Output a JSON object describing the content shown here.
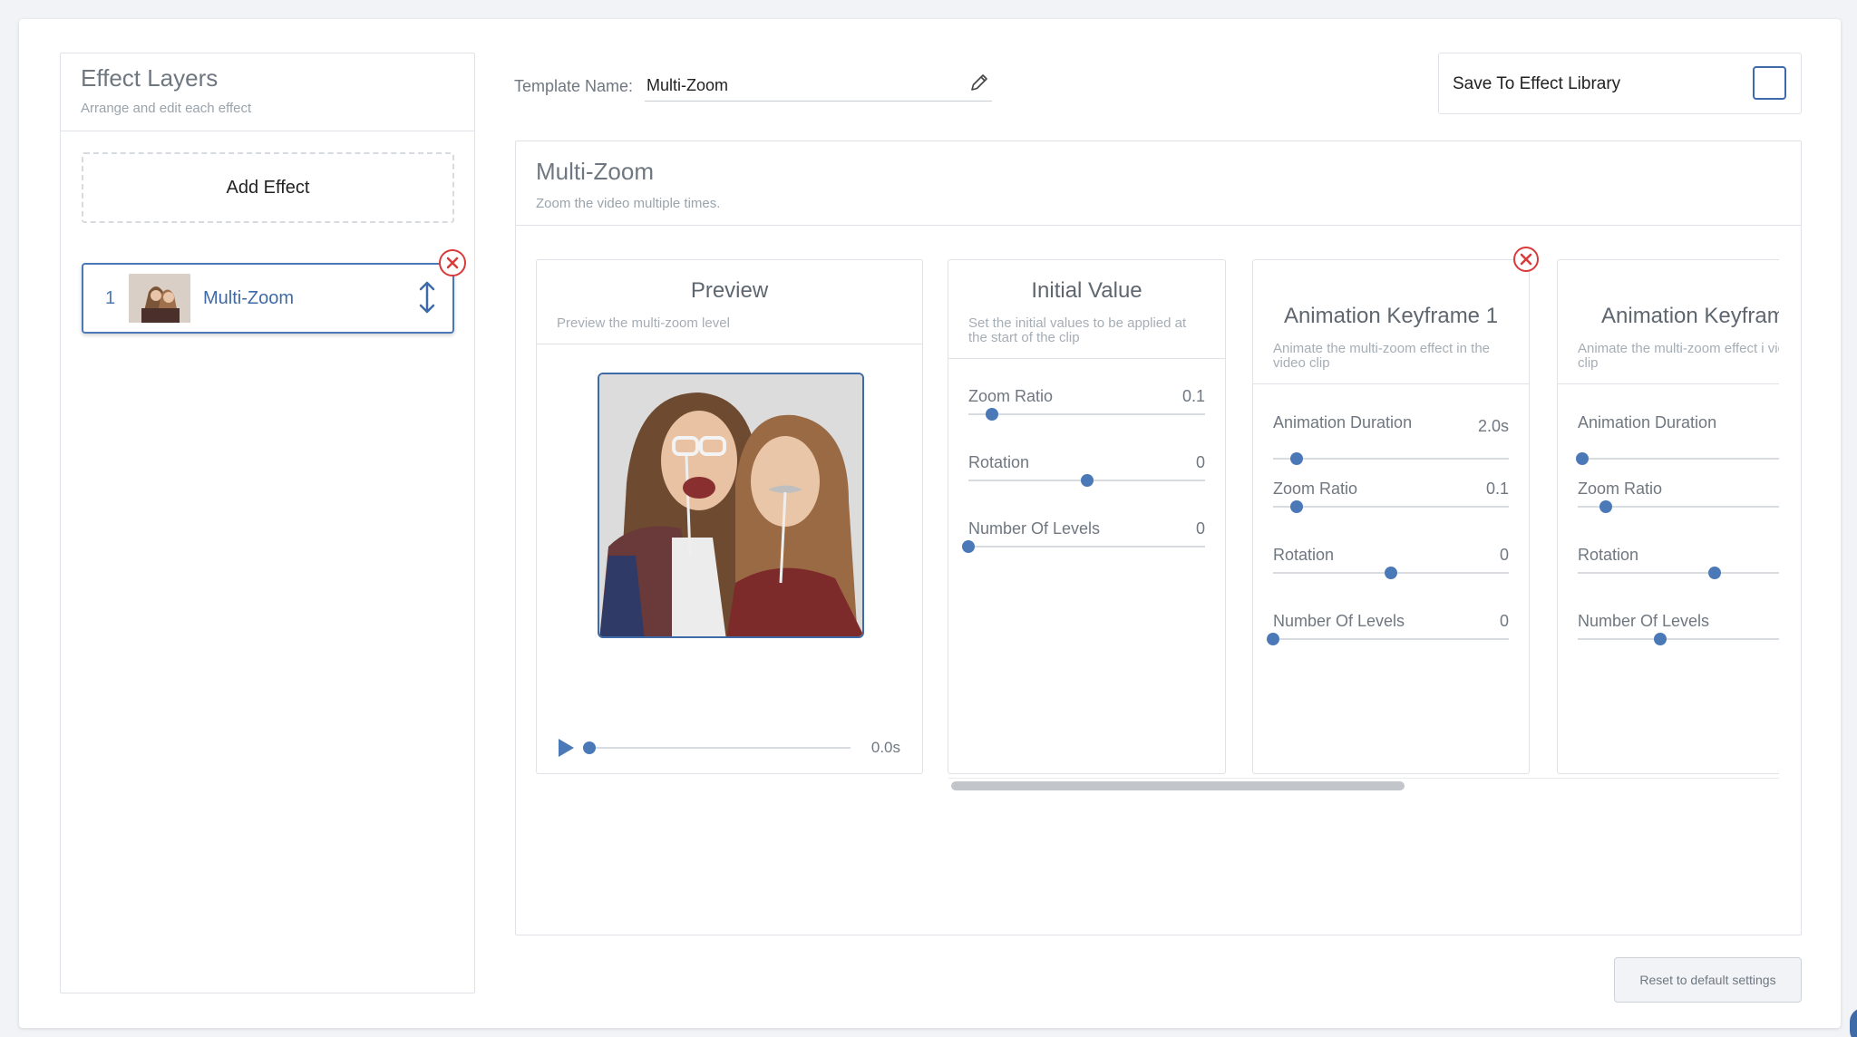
{
  "layers_panel": {
    "title": "Effect Layers",
    "subtitle": "Arrange and edit each effect",
    "add_label": "Add Effect",
    "items": [
      {
        "index": "1",
        "name": "Multi-Zoom"
      }
    ]
  },
  "template": {
    "label": "Template Name:",
    "value": "Multi-Zoom"
  },
  "save_library": {
    "label": "Save To Effect Library",
    "checked": false
  },
  "effect": {
    "title": "Multi-Zoom",
    "subtitle": "Zoom the video multiple times."
  },
  "preview": {
    "title": "Preview",
    "subtitle": "Preview the multi-zoom level",
    "time": "0.0s",
    "progress": 0
  },
  "initial": {
    "title": "Initial Value",
    "subtitle": "Set the initial values to be applied at the start of the clip",
    "sliders": [
      {
        "label": "Zoom Ratio",
        "value": "0.1",
        "pos": 0.1
      },
      {
        "label": "Rotation",
        "value": "0",
        "pos": 0.5
      },
      {
        "label": "Number Of Levels",
        "value": "0",
        "pos": 0.0
      }
    ]
  },
  "keyframe1": {
    "title": "Animation Keyframe 1",
    "subtitle": "Animate the multi-zoom effect in the video clip",
    "sliders": [
      {
        "label": "Animation Duration",
        "value": "2.0s",
        "pos": 0.1
      },
      {
        "label": "Zoom Ratio",
        "value": "0.1",
        "pos": 0.1
      },
      {
        "label": "Rotation",
        "value": "0",
        "pos": 0.5
      },
      {
        "label": "Number Of Levels",
        "value": "0",
        "pos": 0.0
      }
    ]
  },
  "keyframe2": {
    "title": "Animation Keyfram",
    "subtitle": "Animate the multi-zoom effect i video clip",
    "sliders": [
      {
        "label": "Animation Duration",
        "value": "",
        "pos": 0.02
      },
      {
        "label": "Zoom Ratio",
        "value": "",
        "pos": 0.12
      },
      {
        "label": "Rotation",
        "value": "",
        "pos": 0.58
      },
      {
        "label": "Number Of Levels",
        "value": "",
        "pos": 0.35
      }
    ]
  },
  "reset_label": "Reset to default settings",
  "colors": {
    "accent": "#4b79b8",
    "danger": "#d93a3a",
    "border": "#dfe2e6"
  }
}
